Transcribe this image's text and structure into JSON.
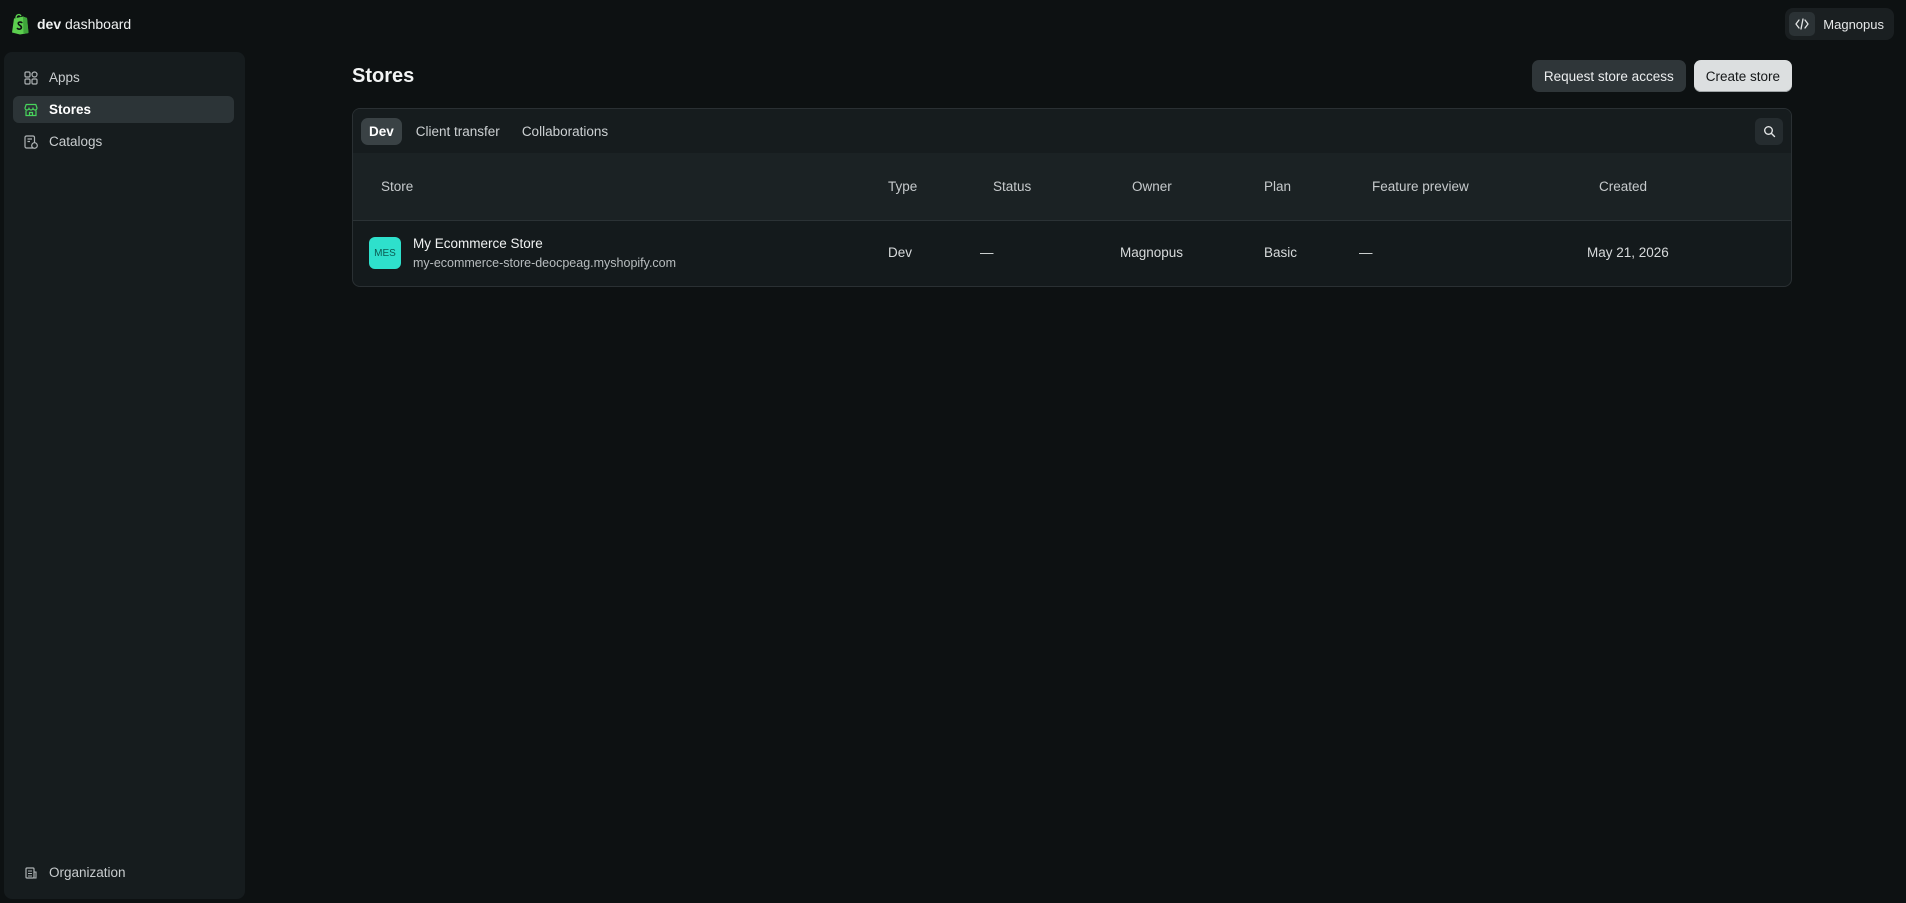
{
  "brand": {
    "bold": "dev",
    "rest": "dashboard"
  },
  "org_switcher": {
    "name": "Magnopus"
  },
  "sidebar": {
    "items": [
      {
        "label": "Apps",
        "icon": "apps-icon",
        "active": false
      },
      {
        "label": "Stores",
        "icon": "store-icon",
        "active": true
      },
      {
        "label": "Catalogs",
        "icon": "catalog-icon",
        "active": false
      }
    ],
    "bottom": {
      "label": "Organization",
      "icon": "organization-icon"
    }
  },
  "page": {
    "title": "Stores",
    "actions": {
      "request_access": "Request store access",
      "create": "Create store"
    }
  },
  "tabs": [
    {
      "label": "Dev",
      "active": true
    },
    {
      "label": "Client transfer",
      "active": false
    },
    {
      "label": "Collaborations",
      "active": false
    }
  ],
  "table": {
    "columns": [
      "Store",
      "Type",
      "Status",
      "Owner",
      "Plan",
      "Feature preview",
      "Created"
    ],
    "rows": [
      {
        "avatar": "MES",
        "name": "My Ecommerce Store",
        "url": "my-ecommerce-store-deocpeag.myshopify.com",
        "type": "Dev",
        "status": "—",
        "owner": "Magnopus",
        "plan": "Basic",
        "feature_preview": "—",
        "created": "May 21, 2026"
      }
    ]
  },
  "colors": {
    "background": "#0d1112",
    "sidebar": "#161c1e",
    "accent_green": "#36c24b",
    "avatar_teal": "#2ee0cc"
  }
}
